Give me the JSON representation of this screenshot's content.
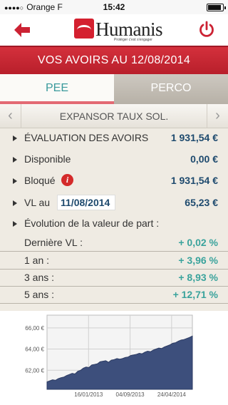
{
  "status_bar": {
    "carrier": "Orange F",
    "time": "15:42",
    "battery_level": 0.9
  },
  "header": {
    "back_icon": "arrow-left-icon",
    "power_icon": "power-icon",
    "logo": {
      "name": "Humanis",
      "tagline": "Protéger c'est s'engager"
    }
  },
  "colors": {
    "brand_red": "#d4303c",
    "teal": "#3a9a9c",
    "navy": "#1e4a6e",
    "chart_fill": "#3d4f7c"
  },
  "title": "VOS AVOIRS AU 12/08/2014",
  "tabs": [
    {
      "label": "PEE",
      "active": true
    },
    {
      "label": "PERCO",
      "active": false
    }
  ],
  "fund": {
    "name": "EXPANSOR TAUX SOL.",
    "prev_icon": "chevron-left-icon",
    "next_icon": "chevron-right-icon"
  },
  "rows": {
    "evaluation": {
      "label": "ÉVALUATION DES AVOIRS",
      "value": "1 931,54 €"
    },
    "disponible": {
      "label": "Disponible",
      "value": "0,00 €"
    },
    "bloque": {
      "label": "Bloqué",
      "value": "1 931,54 €",
      "info_icon": "i"
    },
    "vl": {
      "label": "VL au",
      "date": "11/08/2014",
      "value": "65,23 €"
    },
    "evolution": {
      "label": "Évolution de la valeur de part :"
    }
  },
  "performance": [
    {
      "label": "Dernière VL :",
      "value": "+ 0,02 %"
    },
    {
      "label": "1 an :",
      "value": "+ 3,96 %"
    },
    {
      "label": "3 ans :",
      "value": "+ 8,93 %"
    },
    {
      "label": "5 ans :",
      "value": "+ 12,71 %"
    }
  ],
  "chart_data": {
    "type": "area",
    "y_ticks": [
      "66,00 €",
      "64,00 €",
      "62,00 €"
    ],
    "y_tick_values": [
      66,
      64,
      62
    ],
    "x_ticks": [
      "16/01/2013",
      "04/09/2013",
      "24/04/2014"
    ],
    "ylim": [
      60.2,
      67.2
    ],
    "y_series": [
      60.9,
      61.0,
      61.1,
      61.05,
      61.2,
      61.3,
      61.35,
      61.5,
      61.6,
      61.7,
      61.65,
      61.9,
      62.0,
      62.2,
      62.3,
      62.25,
      62.5,
      62.55,
      62.6,
      62.8,
      62.85,
      62.9,
      62.75,
      62.95,
      63.0,
      63.1,
      63.05,
      63.1,
      63.2,
      63.25,
      63.4,
      63.45,
      63.5,
      63.6,
      63.55,
      63.7,
      63.8,
      63.75,
      63.9,
      64.0,
      64.1,
      64.05,
      64.2,
      64.3,
      64.4,
      64.55,
      64.6,
      64.75,
      64.85,
      64.9,
      65.0,
      65.1,
      65.23
    ]
  }
}
